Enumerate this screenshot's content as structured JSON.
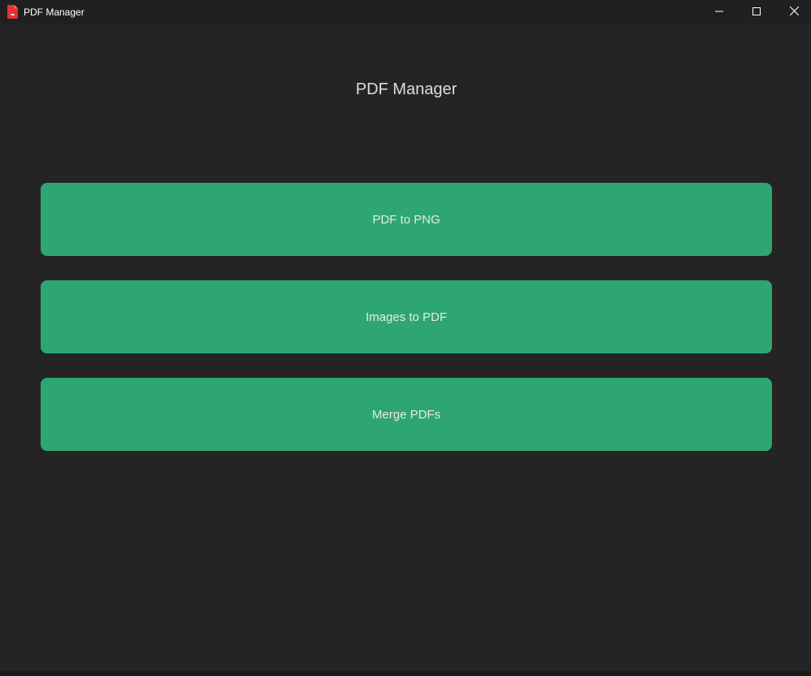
{
  "window": {
    "title": "PDF Manager",
    "app_icon": "pdf-file-icon",
    "controls": {
      "minimize_icon": "minimize-icon",
      "maximize_icon": "maximize-icon",
      "close_icon": "close-icon"
    }
  },
  "main": {
    "heading": "PDF Manager",
    "actions": [
      {
        "label": "PDF to PNG"
      },
      {
        "label": "Images to PDF"
      },
      {
        "label": "Merge PDFs"
      }
    ]
  },
  "colors": {
    "background": "#242424",
    "titlebar": "#202020",
    "button": "#2ea672",
    "button_text": "#e8e8e8",
    "heading_text": "#dcdcdc",
    "icon_red": "#e8312f"
  }
}
